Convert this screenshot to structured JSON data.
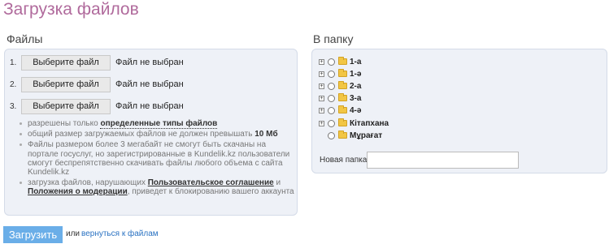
{
  "page": {
    "title": "Загрузка файлов"
  },
  "files": {
    "title": "Файлы",
    "rows": [
      {
        "num": "1.",
        "button": "Выберите файл",
        "status": "Файл не выбран"
      },
      {
        "num": "2.",
        "button": "Выберите файл",
        "status": "Файл не выбран"
      },
      {
        "num": "3.",
        "button": "Выберите файл",
        "status": "Файл не выбран"
      }
    ],
    "rules": {
      "r1_pre": "разрешены только ",
      "r1_link": "определенные типы файлов",
      "r2_pre": "общий размер загружаемых файлов не должен превышать ",
      "r2_strong": "10 Мб",
      "r3": "Файлы размером более 3 мегабайт не смогут быть скачаны на портале госуслуг, но зарегистрированные в Kundelik.kz пользователи смогут беспрепятственно скачивать файлы любого объема с сайта Kundelik.kz",
      "r4_pre": "загрузка файлов, нарушающих ",
      "r4_link1": "Пользовательское соглашение",
      "r4_mid": " и ",
      "r4_link2": "Положения о модерации",
      "r4_post": ", приведет к блокированию вашего аккаунта"
    }
  },
  "folder": {
    "title": "В папку",
    "items": [
      {
        "label": "1-а",
        "expandable": true
      },
      {
        "label": "1-ә",
        "expandable": true
      },
      {
        "label": "2-а",
        "expandable": true
      },
      {
        "label": "3-а",
        "expandable": true
      },
      {
        "label": "4-ә",
        "expandable": true
      },
      {
        "label": "Кітапхана",
        "expandable": true
      },
      {
        "label": "Мұрағат",
        "expandable": false
      }
    ],
    "new_folder_label": "Новая папка",
    "new_folder_value": ""
  },
  "actions": {
    "submit": "Загрузить",
    "or": "или",
    "back": "вернуться к файлам"
  },
  "colors": {
    "title": "#b06a9c",
    "submit_bg": "#6aaee8",
    "link": "#2a72c2",
    "folder_icon": "#f2c644"
  }
}
